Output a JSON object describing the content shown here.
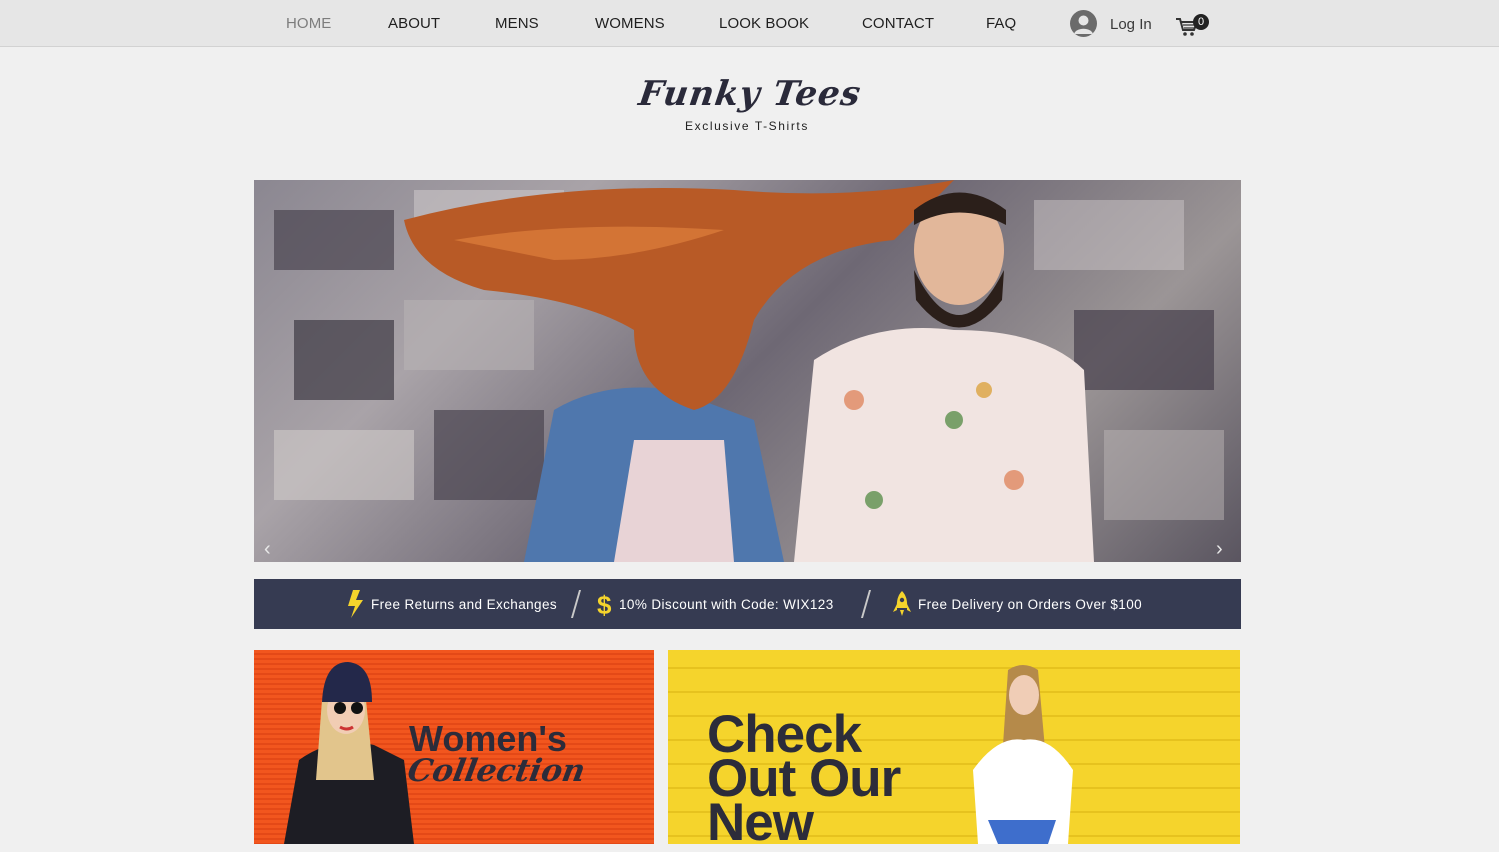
{
  "nav": {
    "items": [
      {
        "label": "HOME",
        "active": true
      },
      {
        "label": "ABOUT"
      },
      {
        "label": "MENS"
      },
      {
        "label": "WOMENS"
      },
      {
        "label": "LOOK BOOK"
      },
      {
        "label": "CONTACT"
      },
      {
        "label": "FAQ"
      }
    ],
    "login_label": "Log In",
    "cart_count": "0",
    "icons": {
      "login": "user-avatar-icon",
      "cart": "shopping-cart-icon"
    }
  },
  "brand": {
    "title": "Funky Tees",
    "subtitle": "Exclusive T-Shirts"
  },
  "hero": {
    "prev_arrow": "‹",
    "next_arrow": "›"
  },
  "promo": {
    "items": [
      {
        "icon": "lightning-icon",
        "text": "Free Returns and Exchanges"
      },
      {
        "icon": "dollar-icon",
        "text": "10% Discount with Code: WIX123"
      },
      {
        "icon": "rocket-icon",
        "text": "Free Delivery on Orders Over $100"
      }
    ],
    "background": "#363b52",
    "icon_color": "#f5d42c"
  },
  "banners": {
    "womens": {
      "title": "Women's",
      "subtitle": "Collection",
      "background": "#f2561e"
    },
    "new": {
      "lines": [
        "Check",
        "Out Our",
        "New"
      ],
      "background": "#f5d42c"
    }
  },
  "colors": {
    "nav_bg": "#e6e6e6",
    "page_bg": "#f0f0f0",
    "text_dark": "#2c2c3a"
  }
}
